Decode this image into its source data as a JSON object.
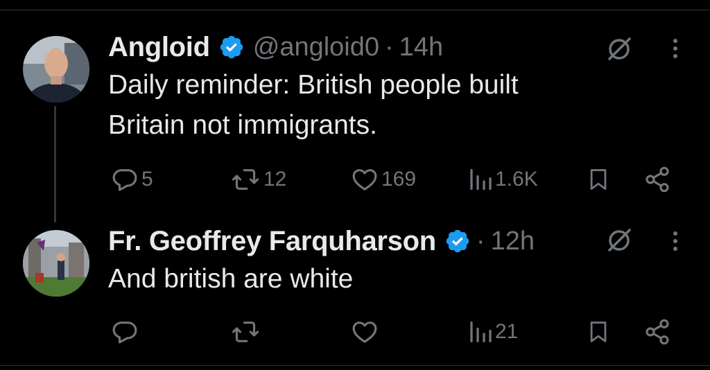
{
  "tweets": [
    {
      "name": "Angloid",
      "handle": "@angloid0",
      "separator": "·",
      "time": "14h",
      "text_lines": [
        "Daily reminder: British people built",
        "Britain not immigrants."
      ],
      "actions": {
        "replies": "5",
        "reposts": "12",
        "likes": "169",
        "views": "1.6K"
      }
    },
    {
      "name": "Fr. Geoffrey Farquharson",
      "separator": "·",
      "time": "12h",
      "text_lines": [
        "And british are white"
      ],
      "actions": {
        "replies": "",
        "reposts": "",
        "likes": "",
        "views": "21"
      }
    }
  ],
  "icons": [
    "verified-badge-icon",
    "grok-icon",
    "more-icon",
    "reply-icon",
    "repost-icon",
    "like-icon",
    "views-icon",
    "bookmark-icon",
    "share-icon"
  ],
  "colors": {
    "background": "#000000",
    "text": "#e7e9ea",
    "muted": "#71767b",
    "verified": "#1d9bf0",
    "divider": "#2f3336"
  }
}
